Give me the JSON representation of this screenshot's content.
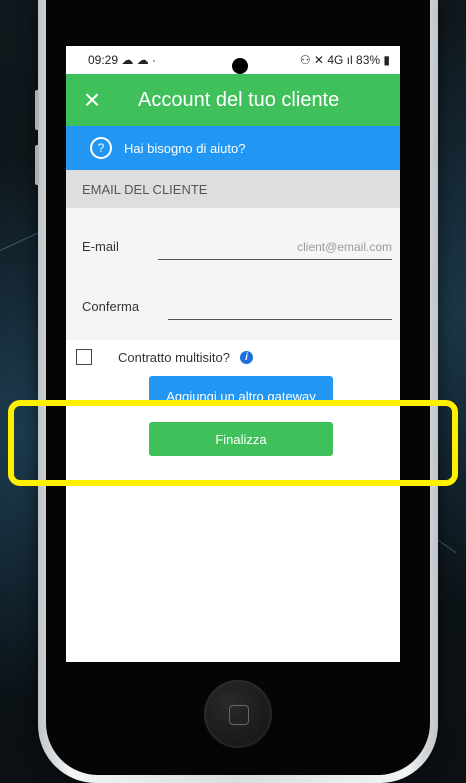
{
  "statusbar": {
    "time": "09:29",
    "left_icons": "☁ ☁ ·",
    "right_icons": "⚇ ✕ 4G ıl",
    "battery": "83%"
  },
  "appbar": {
    "title": "Account del tuo cliente",
    "close_icon": "×"
  },
  "help": {
    "icon": "?",
    "text": "Hai bisogno di aiuto?"
  },
  "section": {
    "header": "EMAIL DEL CLIENTE"
  },
  "form": {
    "email_label": "E-mail",
    "email_placeholder": "client@email.com",
    "confirm_label": "Conferma",
    "confirm_value": ""
  },
  "multisite": {
    "label": "Contratto multisito?",
    "info_icon": "i",
    "checked": false
  },
  "buttons": {
    "add_gateway": "Aggiungi un altro gateway",
    "finalize": "Finalizza"
  },
  "colors": {
    "appbar": "#3fc05a",
    "helpbar": "#2196f3",
    "highlight": "#ffef00"
  }
}
